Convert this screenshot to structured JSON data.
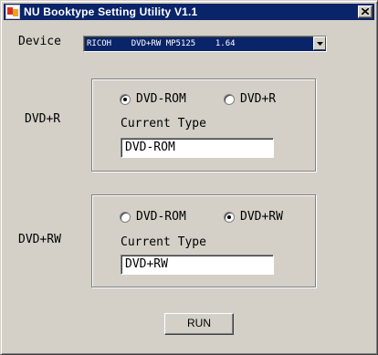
{
  "window": {
    "title": "NU Booktype Setting Utility V1.1"
  },
  "device": {
    "label": "Device",
    "selected": "RICOH    DVD+RW MP5125    1.64"
  },
  "dvd_r": {
    "label": "DVD+R",
    "options": [
      "DVD-ROM",
      "DVD+R"
    ],
    "selected_index": 0,
    "current_type_label": "Current Type",
    "current_type_value": "DVD-ROM"
  },
  "dvd_rw": {
    "label": "DVD+RW",
    "options": [
      "DVD-ROM",
      "DVD+RW"
    ],
    "selected_index": 1,
    "current_type_label": "Current Type",
    "current_type_value": "DVD+RW"
  },
  "actions": {
    "run_label": "RUN"
  }
}
